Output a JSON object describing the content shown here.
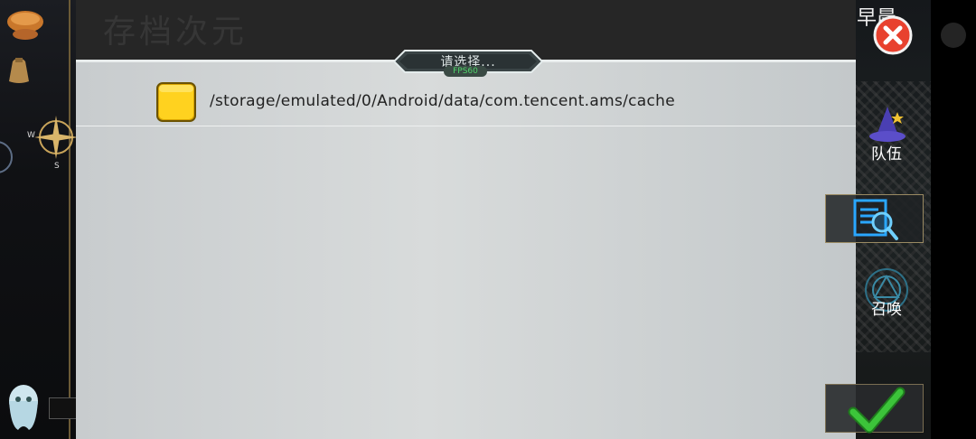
{
  "dialog": {
    "title": "请选择...",
    "fps_label": "FPS60",
    "header_background_text": "存档次元",
    "files": [
      {
        "type": "folder",
        "path": "/storage/emulated/0/Android/data/com.tencent.ams/cache"
      }
    ]
  },
  "right_panel": {
    "time_label": "早晨",
    "nav": [
      {
        "label": "队伍",
        "icon": "wizard-hat-icon"
      },
      {
        "label": "召唤",
        "icon": "summon-circle-icon"
      }
    ],
    "search_icon": "document-search-icon",
    "confirm_icon": "checkmark-icon",
    "close_icon": "close-icon"
  },
  "colors": {
    "dialog_bg": "#d8dbdb",
    "header_bg": "#262626",
    "folder": "#ffd21f",
    "close": "#e8412e",
    "confirm": "#3cc43a",
    "search": "#2aa7ff"
  }
}
